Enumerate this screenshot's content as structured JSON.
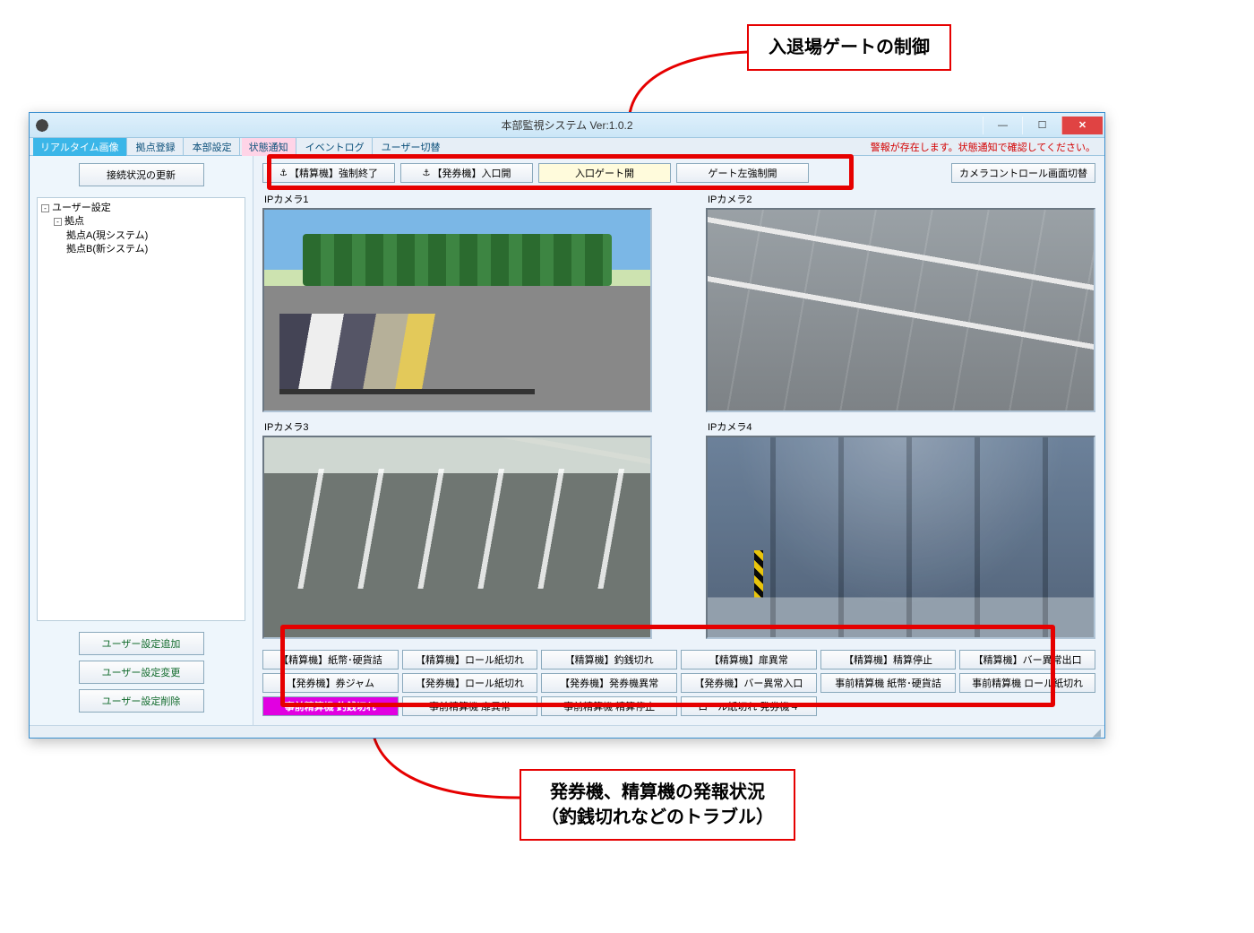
{
  "callouts": {
    "top": "入退場ゲートの制御",
    "bottom_line1": "発券機、精算機の発報状況",
    "bottom_line2": "（釣銭切れなどのトラブル）"
  },
  "window": {
    "title": "本部監視システム  Ver:1.0.2"
  },
  "tabs": {
    "realtime": "リアルタイム画像",
    "site_reg": "拠点登録",
    "hq_config": "本部設定",
    "status": "状態通知",
    "eventlog": "イベントログ",
    "user_switch": "ユーザー切替",
    "alert": "警報が存在します。状態通知で確認してください。"
  },
  "sidebar": {
    "refresh": "接続状況の更新",
    "tree": {
      "root": "ユーザー設定",
      "sites": "拠点",
      "site_a": "拠点A(現システム)",
      "site_b": "拠点B(新システム)"
    },
    "add": "ユーザー設定追加",
    "edit": "ユーザー設定変更",
    "delete": "ユーザー設定削除"
  },
  "toolbar": {
    "btn1": "【精算機】強制終了",
    "btn2": "【発券機】入口開",
    "btn3": "入口ゲート開",
    "btn4": "ゲート左強制開",
    "cam_switch": "カメラコントロール画面切替"
  },
  "cameras": {
    "c1": "IPカメラ1",
    "c2": "IPカメラ2",
    "c3": "IPカメラ3",
    "c4": "IPカメラ4"
  },
  "status": {
    "r1": [
      "【精算機】紙幣･硬貨詰",
      "【精算機】ロール紙切れ",
      "【精算機】釣銭切れ",
      "【精算機】扉異常",
      "【精算機】精算停止",
      "【精算機】バー異常出口"
    ],
    "r2": [
      "【発券機】券ジャム",
      "【発券機】ロール紙切れ",
      "【発券機】発券機異常",
      "【発券機】バー異常入口",
      "事前精算機  紙幣･硬貨詰",
      "事前精算機  ロール紙切れ"
    ],
    "r3": [
      "事前精算機   釣銭切れ",
      "事前精算機  扉異常",
      "事前精算機  精算停止",
      "ロール紙切れ  発券機４",
      "",
      ""
    ],
    "alert_index": 12
  }
}
